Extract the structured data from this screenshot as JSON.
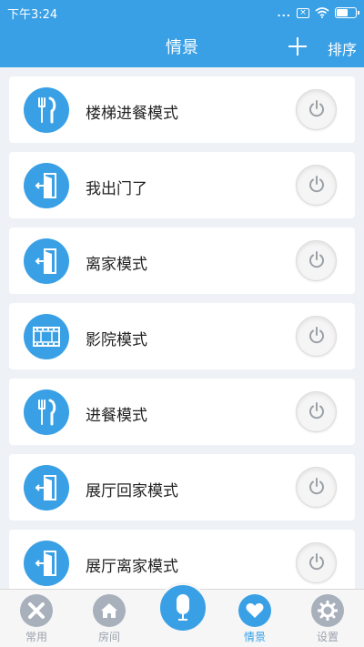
{
  "status_bar": {
    "time": "下午3:24",
    "dots": "...",
    "sim": "×"
  },
  "battery_level": 0.65,
  "header": {
    "title": "情景",
    "sort_label": "排序",
    "add_icon": "plus-icon"
  },
  "scenes": [
    {
      "name": "楼梯进餐模式",
      "icon": "dining-icon"
    },
    {
      "name": "我出门了",
      "icon": "door-icon"
    },
    {
      "name": "离家模式",
      "icon": "door-icon"
    },
    {
      "name": "影院模式",
      "icon": "film-icon"
    },
    {
      "name": "进餐模式",
      "icon": "dining-icon"
    },
    {
      "name": "展厅回家模式",
      "icon": "door-icon"
    },
    {
      "name": "展厅离家模式",
      "icon": "door-icon"
    }
  ],
  "tabs": [
    {
      "label": "常用",
      "icon": "tools-icon",
      "active": false
    },
    {
      "label": "房间",
      "icon": "home-icon",
      "active": false
    },
    {
      "label": "情景",
      "icon": "heart-icon",
      "active": true
    },
    {
      "label": "设置",
      "icon": "gear-icon",
      "active": false
    }
  ],
  "colors": {
    "primary": "#3aa0e6",
    "inactive": "#a7b0bb",
    "background": "#eef1f5"
  }
}
